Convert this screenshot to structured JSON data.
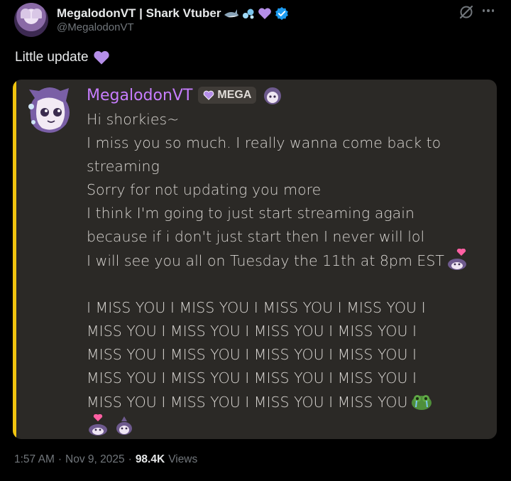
{
  "header": {
    "display_name": "MegalodonVT | Shark Vtuber",
    "handle": "@MegalodonVT",
    "name_emojis": [
      "shark-icon",
      "bubbles-icon",
      "purple-heart-icon"
    ],
    "verified_color": "#1d9bf0"
  },
  "tweet": {
    "text": "Little update",
    "emoji": "purple-heart-icon"
  },
  "embed": {
    "username": "MegalodonVT",
    "username_color": "#c77dff",
    "tag": "MEGA",
    "accent_color": "#f1c40f",
    "lines": [
      "Hi shorkies~",
      "I miss you so much. I really wanna come back to",
      "streaming",
      "Sorry for not updating you more",
      "I think I'm going to just start streaming again",
      "because if i don't just start then I never will lol",
      "I will see you all on Tuesday the 11th at 8pm EST"
    ],
    "miss_lines": [
      "I MISS YOU I MISS YOU I MISS YOU I MISS YOU I",
      "MISS YOU I MISS YOU I MISS YOU I MISS YOU I",
      "MISS YOU I MISS YOU I MISS YOU I MISS YOU I",
      "MISS YOU I MISS YOU I MISS YOU I MISS YOU I",
      "MISS YOU I MISS YOU I MISS YOU I MISS YOU"
    ]
  },
  "footer": {
    "time": "1:57 AM",
    "sep1": "·",
    "date": "Nov 9, 2025",
    "sep2": "·",
    "views_count": "98.4K",
    "views_label": "Views"
  }
}
